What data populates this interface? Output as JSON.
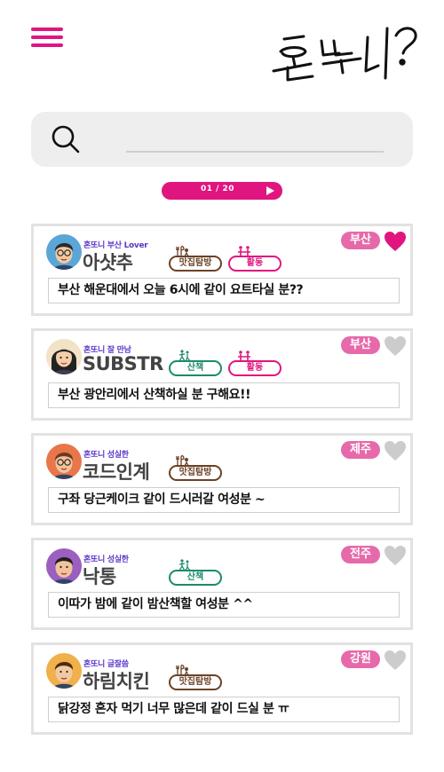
{
  "app": {
    "logo_text": "혼또니?"
  },
  "search": {
    "placeholder": ""
  },
  "pager": {
    "label": "01 / 20"
  },
  "colors": {
    "accent": "#e0157f",
    "heart_active": "#e0157f",
    "heart_inactive": "#cccccc",
    "region_badge": "#e66aaa",
    "handle_text": "#5a35c8"
  },
  "posts": [
    {
      "handle": "혼또니 부산 Lover",
      "username": "아샷추",
      "badges": [
        "맛집탐방",
        "활동"
      ],
      "region": "부산",
      "liked": true,
      "message": "부산 해운대에서 오늘 6시에 같이 요트타실 분??",
      "avatar_icon": "avatar-man-glasses-icon"
    },
    {
      "handle": "혼또니 잘 만남",
      "username": "SUBSTR",
      "badges": [
        "산책",
        "활동"
      ],
      "region": "부산",
      "liked": false,
      "message": "부산 광안리에서 산책하실 분 구해요!!",
      "avatar_icon": "avatar-woman-icon"
    },
    {
      "handle": "혼또니 성실한",
      "username": "코드인계",
      "badges": [
        "맛집탐방"
      ],
      "region": "제주",
      "liked": false,
      "message": "구좌 당근케이크 같이 드시러갈 여성분 ~",
      "avatar_icon": "avatar-man-glasses-icon"
    },
    {
      "handle": "혼또니 성실한",
      "username": "낙통",
      "badges": [
        "산책"
      ],
      "region": "전주",
      "liked": false,
      "message": "이따가 밤에 같이 밤산책할 여성분 ^^",
      "avatar_icon": "avatar-man-icon"
    },
    {
      "handle": "혼또니 글잘씀",
      "username": "하림치킨",
      "badges": [
        "맛집탐방"
      ],
      "region": "강원",
      "liked": false,
      "message": "닭강정 혼자 먹기 너무 많은데 같이 드실 분 ㅠ",
      "avatar_icon": "avatar-man-icon"
    }
  ]
}
